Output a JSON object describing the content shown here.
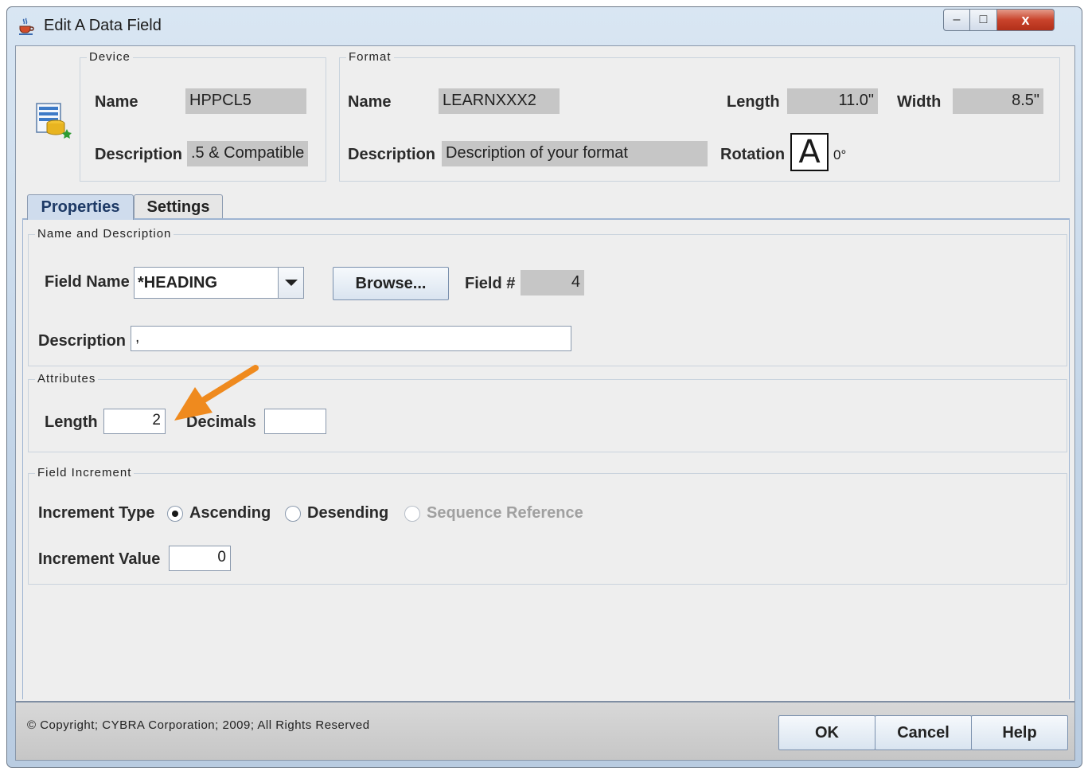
{
  "window": {
    "title": "Edit A Data Field",
    "controls": {
      "minimize": "–",
      "maximize": "□",
      "close": "x"
    }
  },
  "device": {
    "legend": "Device",
    "name_label": "Name",
    "name_value": "HPPCL5",
    "description_label": "Description",
    "description_value": ".5 & Compatible"
  },
  "format": {
    "legend": "Format",
    "name_label": "Name",
    "name_value": "LEARNXXX2",
    "length_label": "Length",
    "length_value": "11.0\"",
    "width_label": "Width",
    "width_value": "8.5\"",
    "description_label": "Description",
    "description_value": "Description of your format",
    "rotation_label": "Rotation",
    "rotation_glyph": "A",
    "rotation_value": "0°"
  },
  "tabs": [
    {
      "label": "Properties",
      "active": true
    },
    {
      "label": "Settings",
      "active": false
    }
  ],
  "name_and_description": {
    "legend": "Name and Description",
    "field_name_label": "Field Name",
    "field_name_value": "*HEADING",
    "browse_label": "Browse...",
    "field_number_label": "Field #",
    "field_number_value": "4",
    "description_label": "Description",
    "description_value": ","
  },
  "attributes": {
    "legend": "Attributes",
    "length_label": "Length",
    "length_value": "2",
    "decimals_label": "Decimals",
    "decimals_value": ""
  },
  "field_increment": {
    "legend": "Field Increment",
    "increment_type_label": "Increment Type",
    "options": [
      {
        "label": "Ascending",
        "checked": true,
        "enabled": true
      },
      {
        "label": "Desending",
        "checked": false,
        "enabled": true
      },
      {
        "label": "Sequence Reference",
        "checked": false,
        "enabled": false
      }
    ],
    "increment_value_label": "Increment Value",
    "increment_value": "0"
  },
  "footer": {
    "copyright": "© Copyright; CYBRA Corporation; 2009; All Rights Reserved",
    "ok_label": "OK",
    "cancel_label": "Cancel",
    "help_label": "Help"
  },
  "colors": {
    "annotation_arrow": "#ef8a1e",
    "readonly_field": "#c6c6c6",
    "active_tab": "#cfdced"
  }
}
